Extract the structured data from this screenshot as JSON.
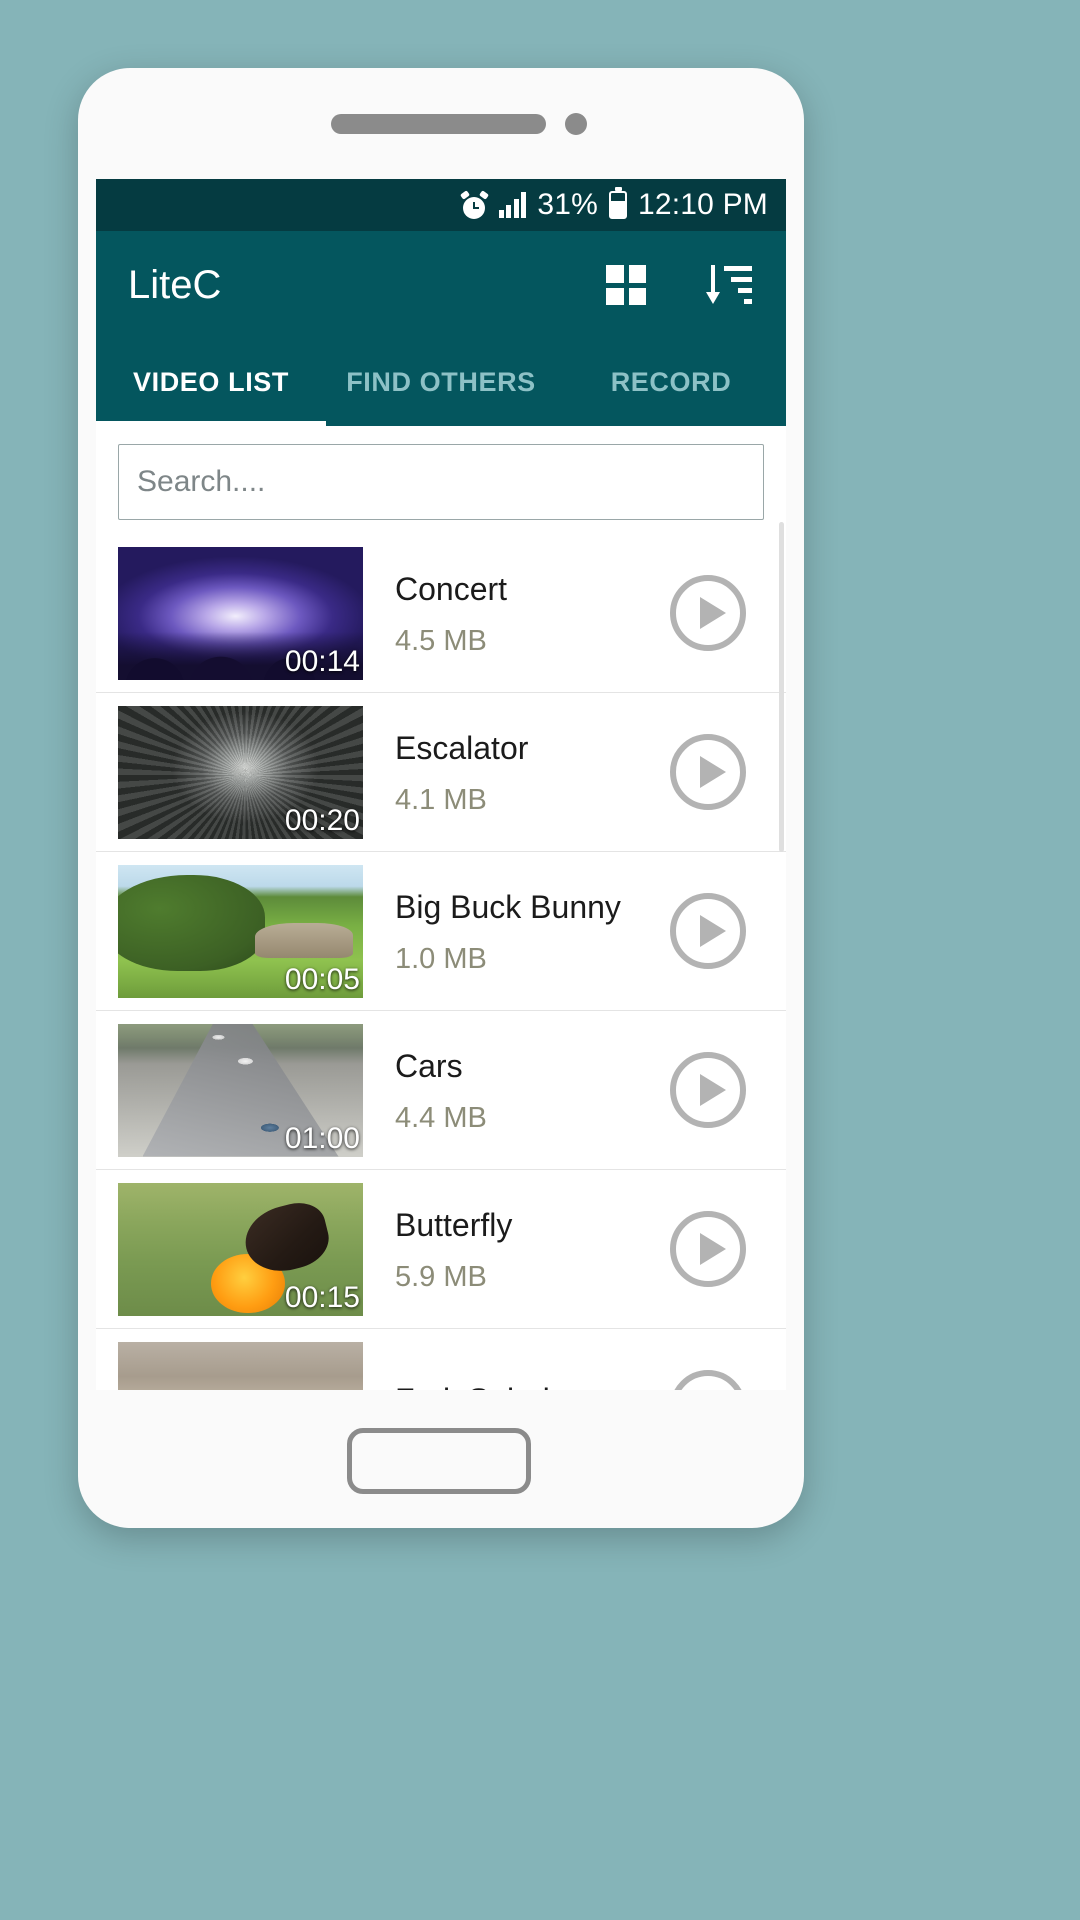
{
  "status_bar": {
    "alarm_icon": "alarm-icon",
    "signal_icon": "signal-bars-icon",
    "battery_percent": "31%",
    "battery_icon": "battery-icon",
    "time": "12:10 PM"
  },
  "app_bar": {
    "title": "LiteC",
    "grid_icon": "grid-view-icon",
    "sort_icon": "sort-descending-icon"
  },
  "tabs": [
    {
      "label": "VIDEO LIST",
      "active": true
    },
    {
      "label": "FIND OTHERS",
      "active": false
    },
    {
      "label": "RECORD",
      "active": false
    }
  ],
  "search": {
    "value": "",
    "placeholder": "Search...."
  },
  "videos": [
    {
      "title": "Concert",
      "size": "4.5 MB",
      "duration": "00:14",
      "art": "art-concert"
    },
    {
      "title": "Escalator",
      "size": "4.1 MB",
      "duration": "00:20",
      "art": "art-escalator"
    },
    {
      "title": "Big Buck Bunny",
      "size": "1.0 MB",
      "duration": "00:05",
      "art": "art-bunny"
    },
    {
      "title": "Cars",
      "size": "4.4 MB",
      "duration": "01:00",
      "art": "art-cars"
    },
    {
      "title": "Butterfly",
      "size": "5.9 MB",
      "duration": "00:15",
      "art": "art-butterfly"
    },
    {
      "title": "Fruit Salad",
      "size": "",
      "duration": "",
      "art": "art-salad"
    }
  ],
  "colors": {
    "status_bar": "#053b41",
    "app_bar": "#04565e",
    "tab_inactive": "#8dc1c6",
    "tab_active": "#ffffff",
    "page_background": "#85b4b8",
    "size_text": "#8c8c78",
    "play_button": "#b3b3b3"
  }
}
